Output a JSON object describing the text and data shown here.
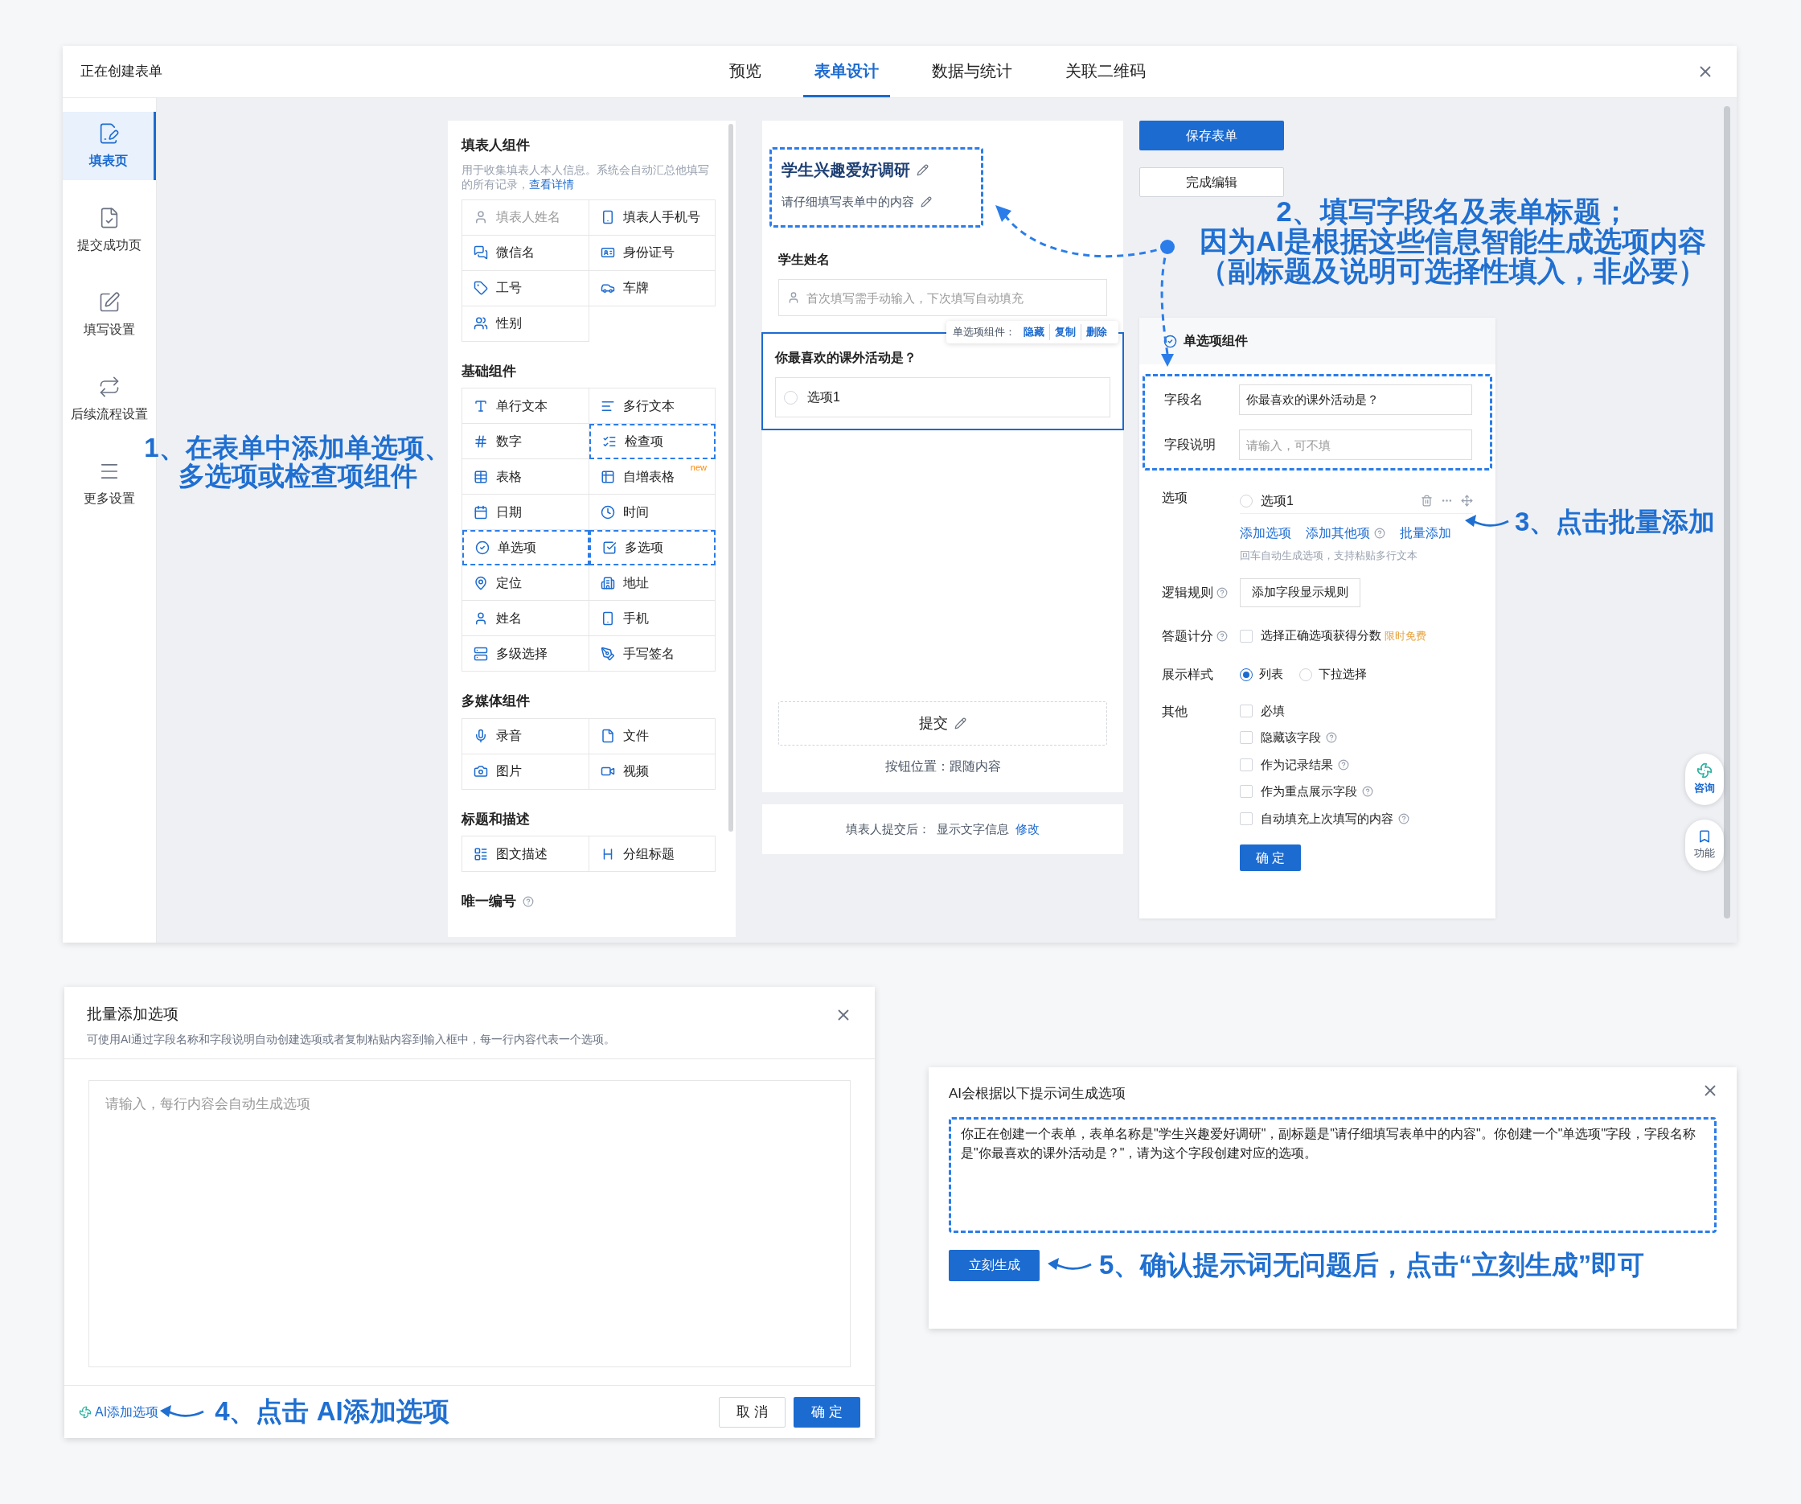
{
  "window": {
    "title": "正在创建表单",
    "tabs": [
      {
        "label": "预览",
        "selected": false
      },
      {
        "label": "表单设计",
        "selected": true
      },
      {
        "label": "数据与统计",
        "selected": false
      },
      {
        "label": "关联二维码",
        "selected": false
      }
    ]
  },
  "sidebar": {
    "items": [
      {
        "label": "填表页",
        "selected": true
      },
      {
        "label": "提交成功页",
        "selected": false
      },
      {
        "label": "填写设置",
        "selected": false
      },
      {
        "label": "后续流程设置",
        "selected": false
      },
      {
        "label": "更多设置",
        "selected": false
      }
    ]
  },
  "component_panel": {
    "sections": [
      {
        "title": "填表人组件",
        "help": false,
        "description": "用于收集填表人本人信息。系统会自动汇总他填写的所有记录，",
        "link": "查看详情",
        "items": [
          {
            "label": "填表人姓名",
            "disabled": true,
            "highlighted": false
          },
          {
            "label": "填表人手机号",
            "disabled": false,
            "highlighted": false
          },
          {
            "label": "微信名",
            "disabled": false,
            "highlighted": false
          },
          {
            "label": "身份证号",
            "disabled": false,
            "highlighted": false
          },
          {
            "label": "工号",
            "disabled": false,
            "highlighted": false
          },
          {
            "label": "车牌",
            "disabled": false,
            "highlighted": false
          },
          {
            "label": "性别",
            "disabled": false,
            "highlighted": false
          }
        ]
      },
      {
        "title": "基础组件",
        "help": false,
        "items": [
          {
            "label": "单行文本",
            "disabled": false,
            "highlighted": false
          },
          {
            "label": "多行文本",
            "disabled": false,
            "highlighted": false
          },
          {
            "label": "数字",
            "disabled": false,
            "highlighted": false
          },
          {
            "label": "检查项",
            "disabled": false,
            "highlighted": true
          },
          {
            "label": "表格",
            "disabled": false,
            "highlighted": false
          },
          {
            "label": "自增表格",
            "badge": "new",
            "disabled": false,
            "highlighted": false
          },
          {
            "label": "日期",
            "disabled": false,
            "highlighted": false
          },
          {
            "label": "时间",
            "disabled": false,
            "highlighted": false
          },
          {
            "label": "单选项",
            "disabled": false,
            "highlighted": true
          },
          {
            "label": "多选项",
            "disabled": false,
            "highlighted": true
          },
          {
            "label": "定位",
            "disabled": false,
            "highlighted": false
          },
          {
            "label": "地址",
            "disabled": false,
            "highlighted": false
          },
          {
            "label": "姓名",
            "disabled": false,
            "highlighted": false
          },
          {
            "label": "手机",
            "disabled": false,
            "highlighted": false
          },
          {
            "label": "多级选择",
            "disabled": false,
            "highlighted": false
          },
          {
            "label": "手写签名",
            "disabled": false,
            "highlighted": false
          }
        ]
      },
      {
        "title": "多媒体组件",
        "help": false,
        "items": [
          {
            "label": "录音",
            "disabled": false,
            "highlighted": false
          },
          {
            "label": "文件",
            "disabled": false,
            "highlighted": false
          },
          {
            "label": "图片",
            "disabled": false,
            "highlighted": false
          },
          {
            "label": "视频",
            "disabled": false,
            "highlighted": false
          }
        ]
      },
      {
        "title": "标题和描述",
        "help": false,
        "items": [
          {
            "label": "图文描述",
            "disabled": false,
            "highlighted": false
          },
          {
            "label": "分组标题",
            "disabled": false,
            "highlighted": false
          }
        ]
      },
      {
        "title": "唯一编号",
        "help": true
      }
    ]
  },
  "form": {
    "title": "学生兴趣爱好调研",
    "subtitle": "请仔细填写表单中的内容",
    "fields": [
      {
        "kind": "text",
        "label": "学生姓名",
        "placeholder": "首次填写需手动输入，下次填写自动填充",
        "selected": false
      },
      {
        "kind": "radio",
        "label": "你最喜欢的课外活动是？",
        "options": [
          "选项1"
        ],
        "selected": true
      }
    ],
    "field_toolbar": {
      "label": "单选项组件：",
      "actions": [
        "隐藏",
        "复制",
        "删除"
      ]
    },
    "submit": {
      "label": "提交",
      "note": "按钮位置：跟随内容"
    },
    "after_submit": {
      "label": "填表人提交后：",
      "value": "显示文字信息",
      "link": "修改"
    }
  },
  "actions": [
    "保存表单",
    "完成编辑"
  ],
  "field_settings": {
    "title": "单选项组件",
    "field_name": {
      "label": "字段名",
      "value": "你最喜欢的课外活动是？"
    },
    "field_desc": {
      "label": "字段说明",
      "placeholder": "请输入，可不填"
    },
    "options": {
      "label": "选项",
      "items": [
        "选项1"
      ],
      "links": [
        {
          "label": "添加选项",
          "help": false
        },
        {
          "label": "添加其他项",
          "help": true
        },
        {
          "label": "批量添加",
          "help": false
        }
      ],
      "hint": "回车自动生成选项，支持粘贴多行文本"
    },
    "logic": {
      "label": "逻辑规则",
      "button": "添加字段显示规则"
    },
    "scoring": {
      "label": "答题计分",
      "checkbox": "选择正确选项获得分数",
      "checked": false,
      "badge": "限时免费"
    },
    "display": {
      "label": "展示样式",
      "choices": [
        {
          "label": "列表",
          "selected": true
        },
        {
          "label": "下拉选择",
          "selected": false
        }
      ]
    },
    "other": {
      "label": "其他",
      "items": [
        {
          "label": "必填",
          "checked": false,
          "help": false
        },
        {
          "label": "隐藏该字段",
          "checked": false,
          "help": true
        },
        {
          "label": "作为记录结果",
          "checked": false,
          "help": true
        },
        {
          "label": "作为重点展示字段",
          "checked": false,
          "help": true
        },
        {
          "label": "自动填充上次填写的内容",
          "checked": false,
          "help": true
        }
      ]
    },
    "confirm": "确 定"
  },
  "floating": [
    "咨询",
    "功能"
  ],
  "batch_dialog": {
    "title": "批量添加选项",
    "description": "可使用AI通过字段名称和字段说明自动创建选项或者复制粘贴内容到输入框中，每一行内容代表一个选项。",
    "placeholder": "请输入，每行内容会自动生成选项",
    "ai_link": "AI添加选项",
    "buttons": [
      "取 消",
      "确 定"
    ]
  },
  "ai_dialog": {
    "title": "AI会根据以下提示词生成选项",
    "prompt": "你正在创建一个表单，表单名称是\"学生兴趣爱好调研\"，副标题是\"请仔细填写表单中的内容\"。你创建一个\"单选项\"字段，字段名称是\"你最喜欢的课外活动是？\"，请为这个字段创建对应的选项。",
    "button": "立刻生成"
  },
  "annotations": [
    {
      "lines": [
        "1、在表单中添加单选项、",
        "多选项或检查项组件"
      ]
    },
    {
      "lines": [
        "2、填写字段名及表单标题；",
        "因为AI是根据这些信息智能生成选项内容",
        "（副标题及说明可选择性填入，非必要）"
      ]
    },
    {
      "lines": [
        "3、点击批量添加"
      ]
    },
    {
      "lines": [
        "4、点击 AI添加选项"
      ]
    },
    {
      "lines": [
        "5、确认提示词无问题后，点击“立刻生成”即可"
      ]
    }
  ]
}
